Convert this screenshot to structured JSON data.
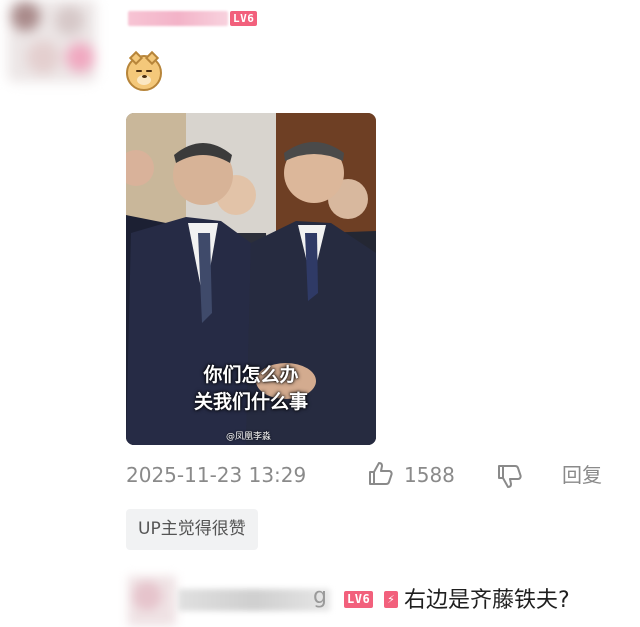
{
  "comment": {
    "author_level": "LV6",
    "image_caption_line1": "你们怎么办",
    "image_caption_line2": "关我们什么事",
    "image_watermark": "@凤凰李淼",
    "timestamp": "2025-11-23 13:29",
    "like_count": "1588",
    "reply_label": "回复",
    "up_tag": "UP主觉得很赞"
  },
  "reply": {
    "author_partial": "g",
    "author_level": "LV6",
    "level_suffix_icon": "lightning-icon",
    "text": "右边是齐藤铁夫?"
  },
  "icons": {
    "emoji": "doge-emoji",
    "like": "thumbs-up-icon",
    "dislike": "thumbs-down-icon"
  },
  "colors": {
    "level_badge": "#f2607c",
    "meta_text": "#8a8a8a",
    "tag_bg": "#f1f2f3"
  }
}
